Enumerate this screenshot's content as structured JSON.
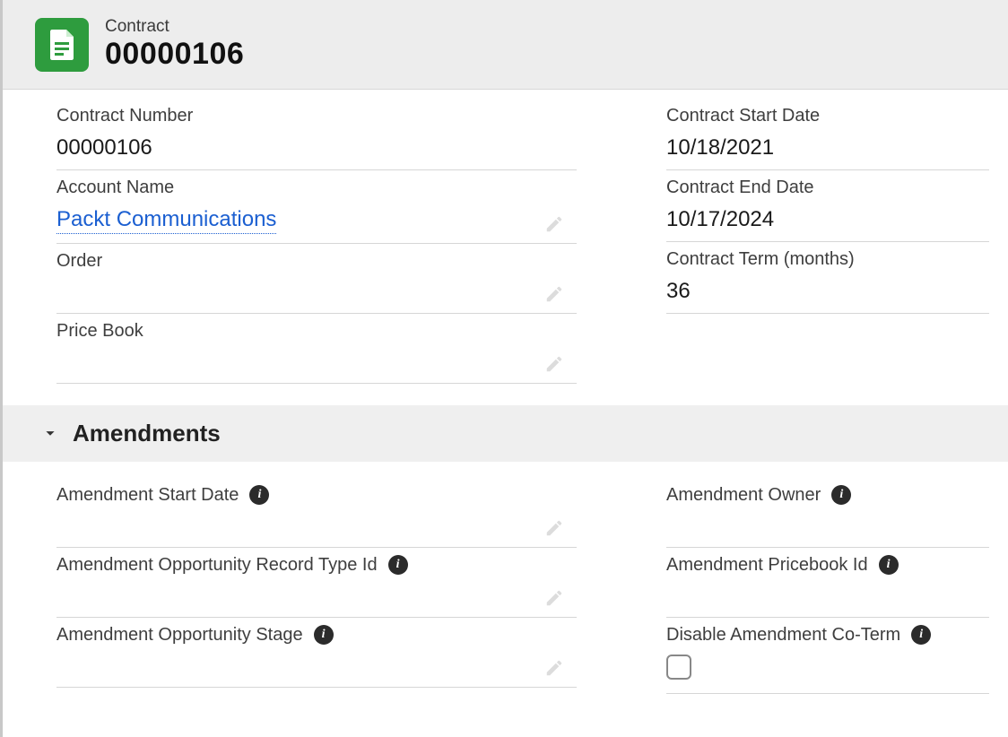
{
  "header": {
    "object_label": "Contract",
    "title": "00000106"
  },
  "section1": {
    "left": [
      {
        "label": "Contract Number",
        "value": "00000106",
        "link": false,
        "editable": false
      },
      {
        "label": "Account Name",
        "value": "Packt Communications",
        "link": true,
        "editable": true
      },
      {
        "label": "Order",
        "value": "",
        "link": false,
        "editable": true
      },
      {
        "label": "Price Book",
        "value": "",
        "link": false,
        "editable": true
      }
    ],
    "right": [
      {
        "label": "Contract Start Date",
        "value": "10/18/2021"
      },
      {
        "label": "Contract End Date",
        "value": "10/17/2024"
      },
      {
        "label": "Contract Term (months)",
        "value": "36"
      }
    ]
  },
  "section2": {
    "title": "Amendments",
    "left": [
      {
        "label": "Amendment Start Date",
        "value": "",
        "info": true,
        "editable": true
      },
      {
        "label": "Amendment Opportunity Record Type Id",
        "value": "",
        "info": true,
        "editable": true
      },
      {
        "label": "Amendment Opportunity Stage",
        "value": "",
        "info": true,
        "editable": true
      }
    ],
    "right": [
      {
        "label": "Amendment Owner",
        "value": "",
        "info": true,
        "editable": false
      },
      {
        "label": "Amendment Pricebook Id",
        "value": "",
        "info": true,
        "editable": false
      },
      {
        "label": "Disable Amendment Co-Term",
        "value": "",
        "info": true,
        "editable": false,
        "checkbox": true
      }
    ]
  }
}
